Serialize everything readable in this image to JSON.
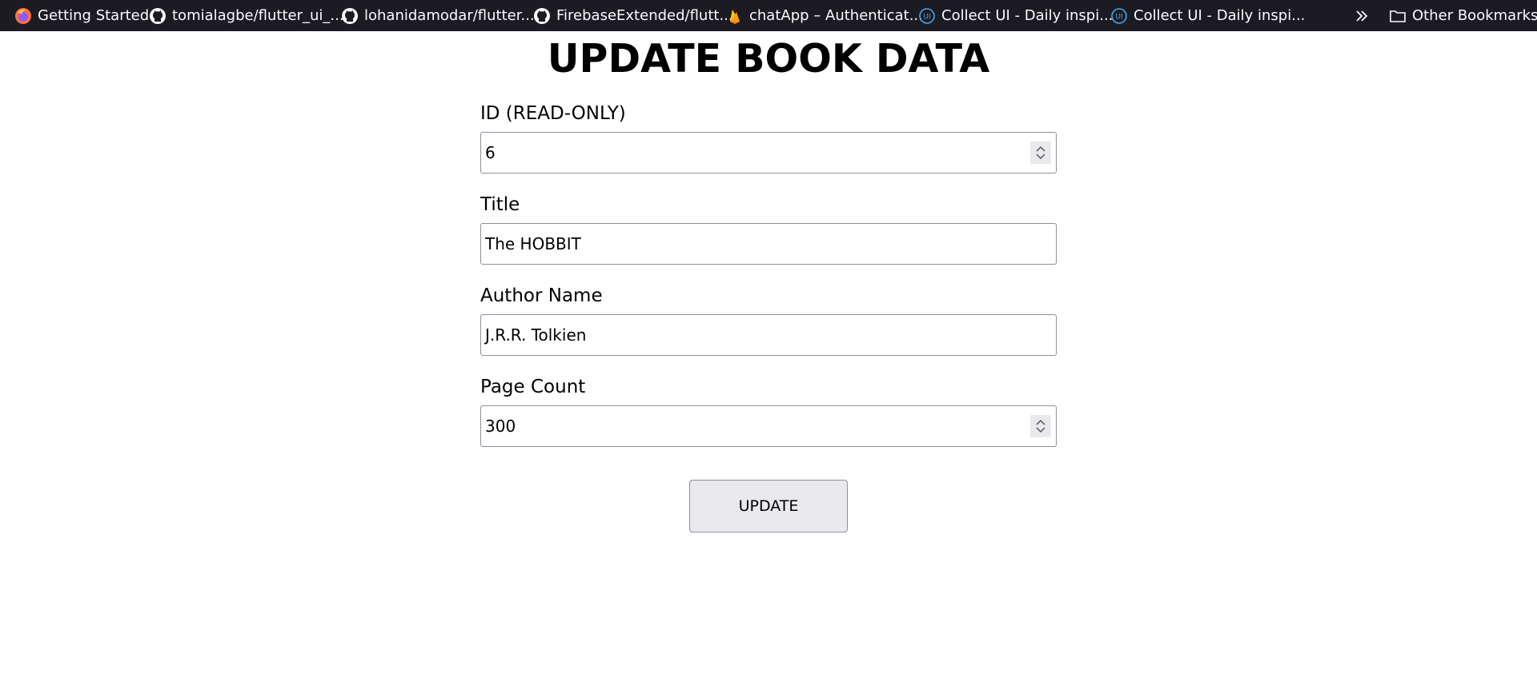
{
  "bookmarks": [
    {
      "label": "Getting Started",
      "icon": "firefox-icon"
    },
    {
      "label": "tomialagbe/flutter_ui_...",
      "icon": "github-icon"
    },
    {
      "label": "lohanidamodar/flutter...",
      "icon": "github-icon"
    },
    {
      "label": "FirebaseExtended/flutt...",
      "icon": "github-icon"
    },
    {
      "label": "chatApp – Authenticat...",
      "icon": "firebase-icon"
    },
    {
      "label": "Collect UI - Daily inspi...",
      "icon": "collectui-icon"
    },
    {
      "label": "Collect UI - Daily inspi...",
      "icon": "collectui-icon"
    }
  ],
  "other_bookmarks": "Other Bookmarks",
  "page": {
    "title": "UPDATE BOOK DATA"
  },
  "form": {
    "id": {
      "label": "ID (READ-ONLY)",
      "value": "6"
    },
    "title": {
      "label": "Title",
      "value": "The HOBBIT"
    },
    "author": {
      "label": "Author Name",
      "value": "J.R.R. Tolkien"
    },
    "page_count": {
      "label": "Page Count",
      "value": "300"
    },
    "submit_label": "UPDATE"
  },
  "colors": {
    "bookmarks_bar_bg": "#1c1b22",
    "button_bg": "#e9e9ed",
    "input_border": "#8f8f9d"
  }
}
